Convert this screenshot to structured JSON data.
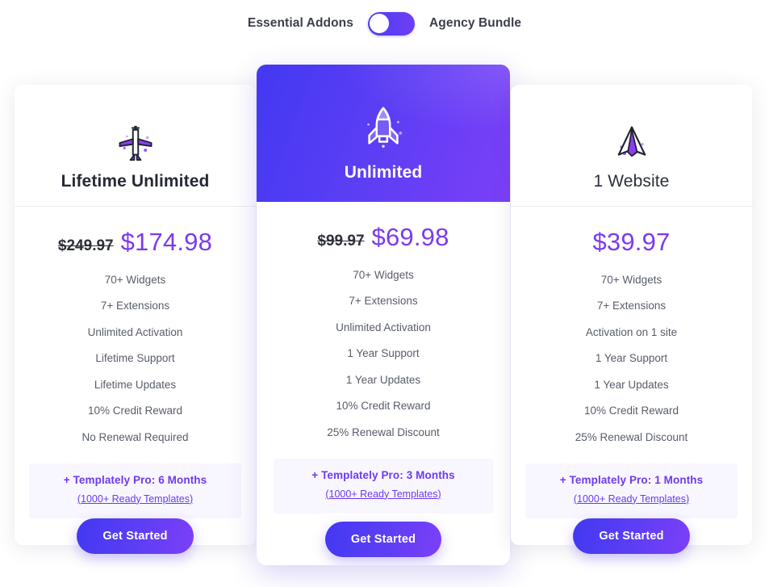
{
  "toggle": {
    "left_label": "Essential Addons",
    "right_label": "Agency Bundle",
    "state": "on",
    "accent_from": "#4c3ff0",
    "accent_to": "#6f3df5"
  },
  "common": {
    "cta_label": "Get Started",
    "promo_link": "(1000+ Ready Templates)",
    "accent_color": "#7c3aed"
  },
  "plans": [
    {
      "id": "lifetime-unlimited",
      "name": "Lifetime Unlimited",
      "icon": "airplane-icon",
      "featured": false,
      "price_old": "$249.97",
      "price_new": "$174.98",
      "features": [
        "70+ Widgets",
        "7+ Extensions",
        "Unlimited Activation",
        "Lifetime Support",
        "Lifetime Updates",
        "10% Credit Reward",
        "No Renewal Required"
      ],
      "promo_title": "+ Templately Pro: 6 Months",
      "promo_link": "(1000+ Ready Templates)",
      "cta_label": "Get Started"
    },
    {
      "id": "unlimited",
      "name": "Unlimited",
      "icon": "rocket-icon",
      "featured": true,
      "price_old": "$99.97",
      "price_new": "$69.98",
      "features": [
        "70+ Widgets",
        "7+ Extensions",
        "Unlimited Activation",
        "1 Year Support",
        "1 Year Updates",
        "10% Credit Reward",
        "25% Renewal Discount"
      ],
      "promo_title": "+ Templately Pro: 3 Months",
      "promo_link": "(1000+ Ready Templates)",
      "cta_label": "Get Started"
    },
    {
      "id": "one-website",
      "name": "1 Website",
      "icon": "paper-plane-icon",
      "featured": false,
      "price_old": "",
      "price_new": "$39.97",
      "features": [
        "70+ Widgets",
        "7+ Extensions",
        "Activation on 1 site",
        "1 Year Support",
        "1 Year Updates",
        "10% Credit Reward",
        "25% Renewal Discount"
      ],
      "promo_title": "+ Templately Pro: 1 Months",
      "promo_link": "(1000+ Ready Templates)",
      "cta_label": "Get Started"
    }
  ]
}
